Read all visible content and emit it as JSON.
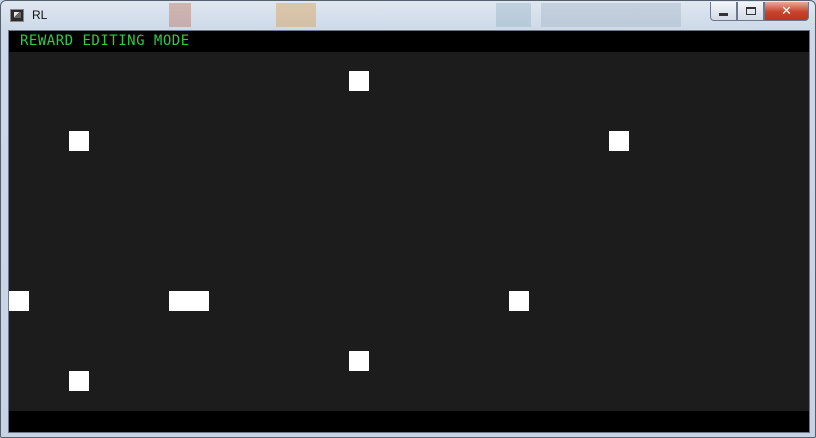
{
  "window": {
    "title": "RL",
    "close_glyph": "✕"
  },
  "editor": {
    "mode_label": "REWARD EDITING MODE",
    "label_color": "#2ecc40",
    "background_color": "#1c1c1c",
    "tile_color": "#ffffff"
  }
}
